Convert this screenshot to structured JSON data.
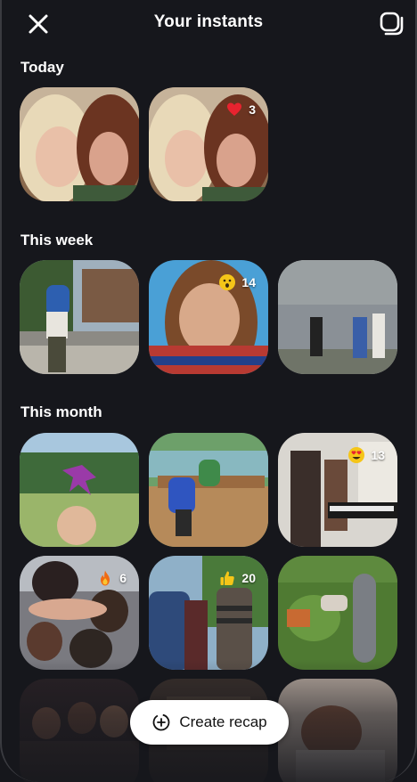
{
  "header": {
    "title": "Your instants",
    "close_icon": "close-icon",
    "layers_icon": "layers-icon"
  },
  "sections": [
    {
      "label": "Today",
      "items": [
        {
          "subject": "two-girls-selfie"
        },
        {
          "subject": "two-girls-selfie",
          "reaction_icon": "heart-icon",
          "count": "3"
        }
      ]
    },
    {
      "label": "This week",
      "items": [
        {
          "subject": "street-piggyback"
        },
        {
          "subject": "girl-closeup-selfie",
          "reaction_icon": "surprised-face-icon",
          "count": "14"
        },
        {
          "subject": "people-by-fence"
        }
      ]
    },
    {
      "label": "This month",
      "items": [
        {
          "subject": "hand-with-pinwheel"
        },
        {
          "subject": "people-at-picnic-table"
        },
        {
          "subject": "girls-with-keyboard",
          "reaction_icon": "heart-eyes-icon",
          "count": "13"
        },
        {
          "subject": "group-selfie-hand",
          "reaction_icon": "fire-icon",
          "count": "6"
        },
        {
          "subject": "friends-outdoors",
          "reaction_icon": "thumbs-up-icon",
          "count": "20"
        },
        {
          "subject": "skateboard-in-grass"
        },
        {
          "subject": "group-on-couch"
        },
        {
          "subject": "dim-room"
        },
        {
          "subject": "person-with-guitar"
        }
      ]
    }
  ],
  "cta": {
    "label": "Create recap",
    "icon": "sparkle-plus-icon"
  },
  "colors": {
    "background": "#16171c",
    "button_bg": "#ffffff",
    "button_text": "#111111",
    "text": "#ffffff"
  }
}
